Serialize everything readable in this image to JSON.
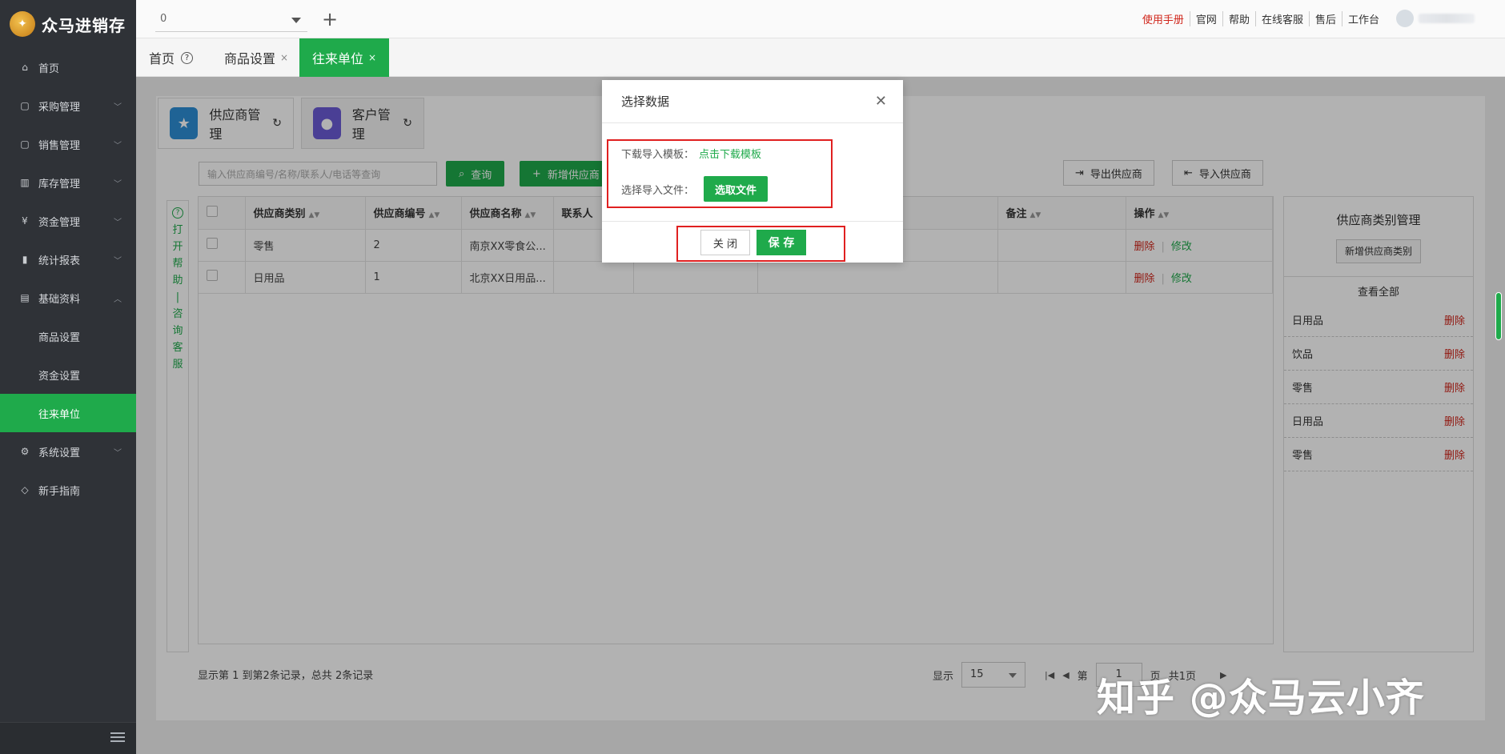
{
  "app": {
    "logo_text": "众马进销存"
  },
  "sidebar": {
    "items": [
      {
        "label": "首页",
        "icon": "home-icon",
        "expandable": false
      },
      {
        "label": "采购管理",
        "icon": "bag-icon",
        "expandable": true
      },
      {
        "label": "销售管理",
        "icon": "bag-icon",
        "expandable": true
      },
      {
        "label": "库存管理",
        "icon": "warehouse-icon",
        "expandable": true
      },
      {
        "label": "资金管理",
        "icon": "money-icon",
        "expandable": true
      },
      {
        "label": "统计报表",
        "icon": "chart-icon",
        "expandable": true
      },
      {
        "label": "基础资料",
        "icon": "doc-icon",
        "expandable": true,
        "expanded": true
      },
      {
        "label": "商品设置",
        "sub": true
      },
      {
        "label": "资金设置",
        "sub": true
      },
      {
        "label": "往来单位",
        "sub": true,
        "active": true
      },
      {
        "label": "系统设置",
        "icon": "gear-icon",
        "expandable": true
      },
      {
        "label": "新手指南",
        "icon": "tag-icon",
        "expandable": false
      }
    ]
  },
  "header": {
    "store_select": "0",
    "links": [
      "使用手册",
      "官网",
      "帮助",
      "在线客服",
      "售后",
      "工作台"
    ]
  },
  "tabs": [
    {
      "label": "首页",
      "closable": false,
      "help": "?"
    },
    {
      "label": "商品设置",
      "closable": true
    },
    {
      "label": "往来单位",
      "closable": true,
      "active": true
    }
  ],
  "partner_tabs": [
    {
      "label": "供应商管理",
      "color": "#2d8fd6"
    },
    {
      "label": "客户管理",
      "color": "#6a5bd6"
    }
  ],
  "toolbar": {
    "search_placeholder": "输入供应商编号/名称/联系人/电话等查询",
    "query_label": "查询",
    "add_label": "新增供应商",
    "export_label": "导出供应商",
    "import_label": "导入供应商"
  },
  "help_strip": {
    "chars": [
      "打",
      "开",
      "帮",
      "助",
      "|",
      "咨",
      "询",
      "客",
      "服"
    ]
  },
  "table": {
    "headers": [
      "供应商类别",
      "供应商编号",
      "供应商名称",
      "联系人",
      "备注",
      "操作"
    ],
    "rows": [
      {
        "category": "零售",
        "code": "2",
        "name": "南京XX零食公...",
        "contact": "",
        "note": ""
      },
      {
        "category": "日用品",
        "code": "1",
        "name": "北京XX日用品...",
        "contact": "",
        "note": ""
      }
    ],
    "delete_label": "删除",
    "edit_label": "修改"
  },
  "category_panel": {
    "title": "供应商类别管理",
    "add_label": "新增供应商类别",
    "view_all": "查看全部",
    "items": [
      "日用品",
      "饮品",
      "零售",
      "日用品",
      "零售"
    ],
    "delete_label": "删除"
  },
  "footer": {
    "records_text": "显示第 1 到第2条记录，总共 2条记录",
    "show_label": "显示",
    "page_size": "15",
    "page_label": "页",
    "total_pages": "共1页"
  },
  "modal": {
    "title": "选择数据",
    "download_label": "下载导入模板：",
    "download_link": "点击下载模板",
    "file_label": "选择导入文件：",
    "file_button": "选取文件",
    "close_label": "关 闭",
    "save_label": "保 存"
  },
  "watermark": "知乎 @众马云小齐",
  "colors": {
    "accent": "#1faa4b",
    "danger": "#d0251a",
    "sidebar": "#2f3237"
  }
}
